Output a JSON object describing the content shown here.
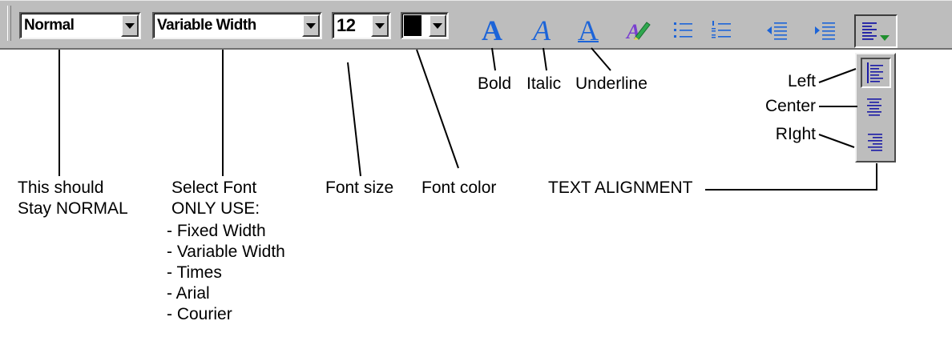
{
  "toolbar": {
    "style_select": {
      "value": "Normal"
    },
    "font_select": {
      "value": "Variable Width"
    },
    "size_select": {
      "value": "12"
    },
    "color_select": {
      "value": "#000000"
    },
    "icons": [
      "bold-icon",
      "italic-icon",
      "underline-icon",
      "highlighter-icon",
      "bulleted-list-icon",
      "numbered-list-icon",
      "decrease-indent-icon",
      "increase-indent-icon",
      "align-left-icon"
    ],
    "letters": {
      "bold": "A",
      "italic": "A",
      "underline": "A"
    },
    "accent_color": "#1c64d8",
    "align_color": "#1a1aa6"
  },
  "align_menu": {
    "options": [
      "Left",
      "Center",
      "RIght"
    ],
    "selected": "Left"
  },
  "annotations": {
    "bold": "Bold",
    "italic": "Italic",
    "underline": "Underline",
    "left": "Left",
    "center": "Center",
    "right": "RIght",
    "style_note": [
      "This should",
      "Stay NORMAL"
    ],
    "font_note": {
      "heading": [
        "Select Font",
        "ONLY USE:"
      ],
      "items": [
        "- Fixed Width",
        "- Variable Width",
        "- Times",
        "- Arial",
        "- Courier"
      ]
    },
    "font_size": "Font size",
    "font_color": "Font color",
    "text_alignment": "TEXT ALIGNMENT"
  }
}
